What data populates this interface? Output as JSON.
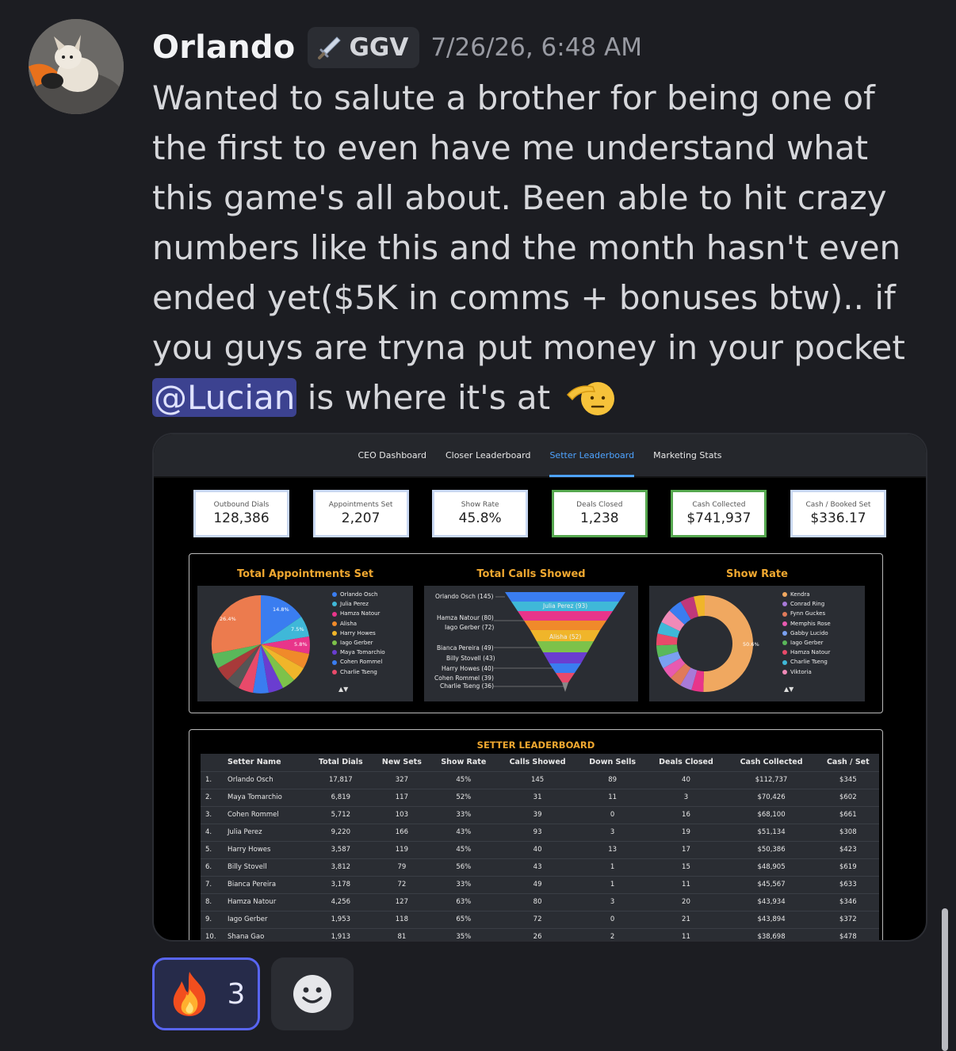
{
  "author": {
    "name": "Orlando",
    "role": "GGV",
    "timestamp": "7/26/26, 6:48 AM",
    "role_icon": "sword-icon"
  },
  "message": {
    "text": "Wanted to salute a brother for being one of the first to even have me understand what this game's all about. Been able to hit crazy numbers like this and the month hasn't even ended yet($5K in comms + bonuses btw).. if you guys are tryna put money in your pocket",
    "mention": "@Lucian",
    "tail": "is where it's at",
    "emoji": "saluting-face"
  },
  "dashboard": {
    "nav": [
      "CEO Dashboard",
      "Closer Leaderboard",
      "Setter Leaderboard",
      "Marketing Stats"
    ],
    "active_tab": "Setter Leaderboard",
    "kpis": [
      {
        "label": "Outbound Dials",
        "value": "128,386"
      },
      {
        "label": "Appointments Set",
        "value": "2,207"
      },
      {
        "label": "Show Rate",
        "value": "45.8%"
      },
      {
        "label": "Deals Closed",
        "value": "1,238"
      },
      {
        "label": "Cash Collected",
        "value": "$741,937"
      },
      {
        "label": "Cash / Booked Set",
        "value": "$336.17"
      }
    ],
    "appointments_chart": {
      "title": "Total Appointments Set",
      "legend": [
        "Orlando Osch",
        "Julia Perez",
        "Hamza Natour",
        "Alisha",
        "Harry Howes",
        "Iago Gerber",
        "Maya Tomarchio",
        "Cohen Rommel",
        "Charlie Tseng"
      ],
      "slice_labels": [
        "26.4%",
        "14.8%",
        "7.5%",
        "5.8%"
      ],
      "arrows": "▲▼"
    },
    "calls_chart": {
      "title": "Total Calls Showed",
      "labels": [
        "Orlando Osch (145)",
        "Hamza Natour (80)",
        "Iago Gerber (72)",
        "Bianca Pereira (49)",
        "Billy Stovell (43)",
        "Harry Howes (40)",
        "Cohen Rommel (39)",
        "Charlie Tseng (36)"
      ],
      "inner_labels": [
        "Julia Perez (93)",
        "Alisha (52)"
      ]
    },
    "show_rate_chart": {
      "title": "Show Rate",
      "legend": [
        "Kendra",
        "Conrad Ring",
        "Fynn Guckes",
        "Memphis Rose",
        "Gabby Lucido",
        "Iago Gerber",
        "Hamza Natour",
        "Charlie Tseng",
        "Viktoria"
      ],
      "big_slice_label": "50.6%",
      "arrows": "▲▼"
    },
    "leaderboard": {
      "title": "SETTER LEADERBOARD",
      "columns": [
        "Setter Name",
        "Total Dials",
        "New Sets",
        "Show Rate",
        "Calls Showed",
        "Down Sells",
        "Deals Closed",
        "Cash Collected",
        "Cash / Set"
      ],
      "rows": [
        [
          "1.",
          "Orlando Osch",
          "17,817",
          "327",
          "45%",
          "145",
          "89",
          "40",
          "$112,737",
          "$345"
        ],
        [
          "2.",
          "Maya Tomarchio",
          "6,819",
          "117",
          "52%",
          "31",
          "11",
          "3",
          "$70,426",
          "$602"
        ],
        [
          "3.",
          "Cohen Rommel",
          "5,712",
          "103",
          "33%",
          "39",
          "0",
          "16",
          "$68,100",
          "$661"
        ],
        [
          "4.",
          "Julia Perez",
          "9,220",
          "166",
          "43%",
          "93",
          "3",
          "19",
          "$51,134",
          "$308"
        ],
        [
          "5.",
          "Harry Howes",
          "3,587",
          "119",
          "45%",
          "40",
          "13",
          "17",
          "$50,386",
          "$423"
        ],
        [
          "6.",
          "Billy Stovell",
          "3,812",
          "79",
          "56%",
          "43",
          "1",
          "15",
          "$48,905",
          "$619"
        ],
        [
          "7.",
          "Bianca Pereira",
          "3,178",
          "72",
          "33%",
          "49",
          "1",
          "11",
          "$45,567",
          "$633"
        ],
        [
          "8.",
          "Hamza Natour",
          "4,256",
          "127",
          "63%",
          "80",
          "3",
          "20",
          "$43,934",
          "$346"
        ],
        [
          "9.",
          "Iago Gerber",
          "1,953",
          "118",
          "65%",
          "72",
          "0",
          "21",
          "$43,894",
          "$372"
        ],
        [
          "10.",
          "Shana Gao",
          "1,913",
          "81",
          "35%",
          "26",
          "2",
          "11",
          "$38,698",
          "$478"
        ]
      ]
    }
  },
  "reactions": [
    {
      "emoji": "fire",
      "count": "3"
    }
  ],
  "colors": {
    "accent": "#5865f2",
    "mention_bg": "#3c4290",
    "chart_title": "#f0a830",
    "active_tab": "#4ea3ff"
  }
}
